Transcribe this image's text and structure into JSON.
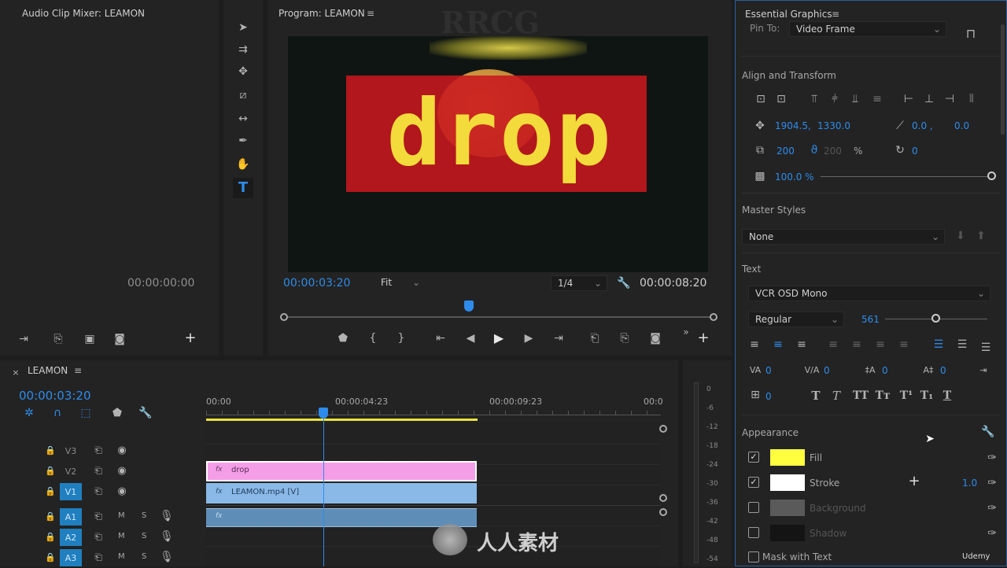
{
  "audio_mixer": {
    "title": "Audio Clip Mixer: LEAMON",
    "timecode": "00:00:00:00"
  },
  "tools": [
    "selection-tool",
    "track-select-tool",
    "ripple-edit-tool",
    "razor-tool",
    "slip-tool",
    "pen-tool",
    "hand-tool",
    "type-tool"
  ],
  "program": {
    "title": "Program: LEAMON",
    "overlay_text": "drop",
    "current_time": "00:00:03:20",
    "fit": "Fit",
    "resolution": "1/4",
    "duration": "00:00:08:20",
    "playhead_fraction": 0.43
  },
  "timeline": {
    "tab": "LEAMON",
    "timecode": "00:00:03:20",
    "ruler": [
      "00:00",
      "00:00:04:23",
      "00:00:09:23",
      "00:0"
    ],
    "tracks_video": [
      {
        "name": "V3",
        "targeted": false
      },
      {
        "name": "V2",
        "targeted": false
      },
      {
        "name": "V1",
        "targeted": true
      }
    ],
    "tracks_audio": [
      {
        "name": "A1",
        "targeted": true,
        "m": "M",
        "s": "S"
      },
      {
        "name": "A2",
        "targeted": true,
        "m": "M",
        "s": "S"
      },
      {
        "name": "A3",
        "targeted": true,
        "m": "M",
        "s": "S"
      }
    ],
    "clips": {
      "v2": "drop",
      "v1": "LEAMON.mp4 [V]"
    },
    "meter_scale": [
      "0",
      "-6",
      "-12",
      "-18",
      "-24",
      "-30",
      "-36",
      "-42",
      "-48",
      "-54"
    ],
    "clip_fx": "fx"
  },
  "essential_graphics": {
    "title": "Essential Graphics",
    "pin_to_label": "Pin To:",
    "pin_to_value": "Video Frame",
    "align_title": "Align and Transform",
    "position_x": "1904.5,",
    "position_y": "1330.0",
    "anchor_x": "0.0 ,",
    "anchor_y": "0.0",
    "scale": "200",
    "scale_linked": "200",
    "scale_unit": "%",
    "rotation": "0",
    "opacity": "100.0 %",
    "master_styles_title": "Master Styles",
    "master_styles_value": "None",
    "text_title": "Text",
    "font": "VCR OSD Mono",
    "font_style": "Regular",
    "font_size": "561",
    "font_size_fraction": 0.49,
    "tracking_vals": [
      "0",
      "0",
      "0",
      "0"
    ],
    "baseline": "0",
    "style_buttons": [
      "T",
      "T",
      "TT",
      "Tт",
      "T¹",
      "T₁",
      "T"
    ],
    "appearance_title": "Appearance",
    "fill": {
      "label": "Fill",
      "color": "#ffff40",
      "checked": true
    },
    "stroke": {
      "label": "Stroke",
      "color": "#ffffff",
      "checked": true,
      "width": "1.0"
    },
    "background": {
      "label": "Background",
      "color": "#5a5a5a",
      "checked": false
    },
    "shadow": {
      "label": "Shadow",
      "color": "#141414",
      "checked": false
    },
    "mask_label": "Mask with Text",
    "brand": "Udemy"
  },
  "watermarks": {
    "rrcg": "RRCG",
    "cn": "人人素材"
  },
  "colors": {
    "accent": "#2d8ceb",
    "v2_clip": "#f59ee8",
    "v1_clip": "#8ab9e8",
    "a1_clip": "#5e8db7",
    "drop_bg": "#c8181e",
    "drop_text": "#f2db3a"
  }
}
